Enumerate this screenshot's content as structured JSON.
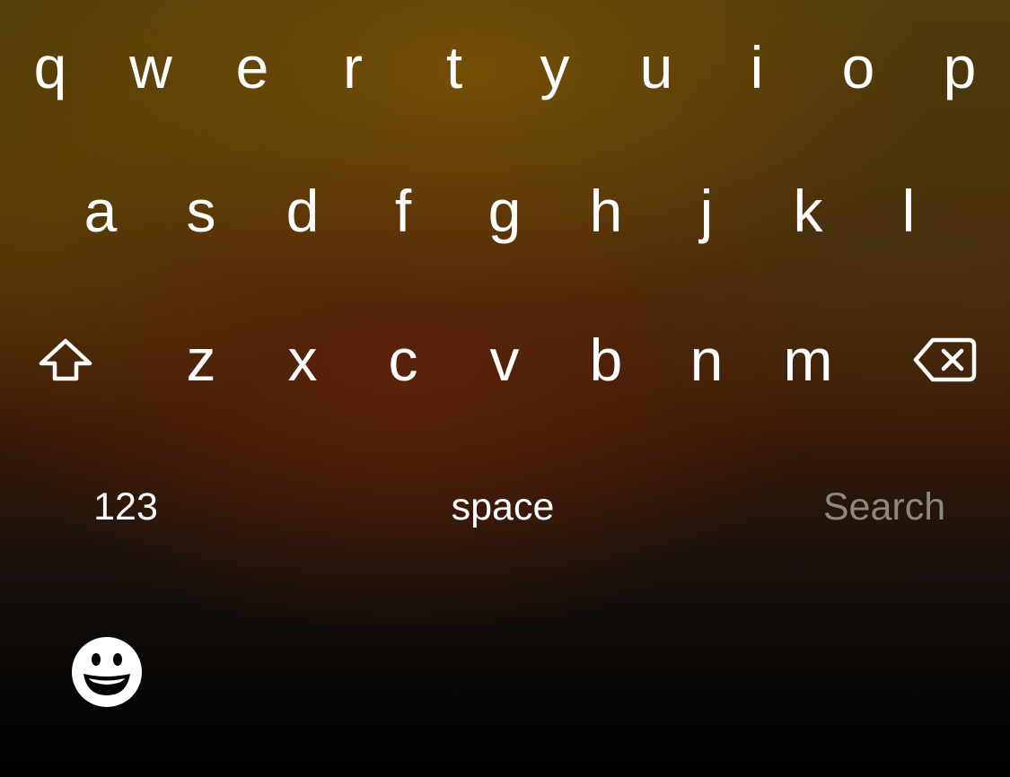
{
  "keyboard": {
    "rows": [
      [
        "q",
        "w",
        "e",
        "r",
        "t",
        "y",
        "u",
        "i",
        "o",
        "p"
      ],
      [
        "a",
        "s",
        "d",
        "f",
        "g",
        "h",
        "j",
        "k",
        "l"
      ],
      [
        "z",
        "x",
        "c",
        "v",
        "b",
        "n",
        "m"
      ]
    ],
    "shift_icon": "shift-arrow-icon",
    "delete_icon": "backspace-icon",
    "numbers_label": "123",
    "space_label": "space",
    "return_label": "Search",
    "emoji_icon": "emoji-smiley-icon"
  },
  "colors": {
    "key_text": "#ffffff",
    "return_text_disabled": "#8c8780"
  }
}
